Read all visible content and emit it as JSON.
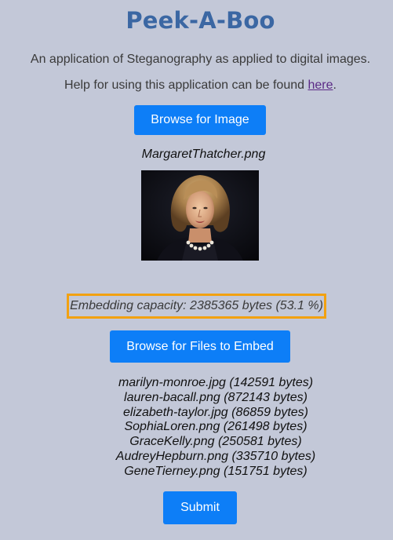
{
  "app": {
    "title": "Peek-A-Boo",
    "subtitle": "An application of Steganography as applied to digital images.",
    "help_prefix": "Help for using this application can be found ",
    "help_link": "here",
    "help_suffix": "."
  },
  "image_section": {
    "browse_label": "Browse for Image",
    "filename": "MargaretThatcher.png"
  },
  "capacity": {
    "text": "Embedding capacity: 2385365 bytes (53.1 %)",
    "highlight_color": "#f2a111"
  },
  "embed_section": {
    "browse_label": "Browse for Files to Embed",
    "files": [
      "marilyn-monroe.jpg (142591 bytes)",
      "lauren-bacall.png (872143 bytes)",
      "elizabeth-taylor.jpg (86859 bytes)",
      "SophiaLoren.png (261498 bytes)",
      "GraceKelly.png (250581 bytes)",
      "AudreyHepburn.png (335710 bytes)",
      "GeneTierney.png (151751 bytes)"
    ]
  },
  "submit_label": "Submit",
  "colors": {
    "background": "#c3c8d8",
    "title": "#3b67a3",
    "button": "#0d7ef7",
    "link": "#5b2a86"
  }
}
